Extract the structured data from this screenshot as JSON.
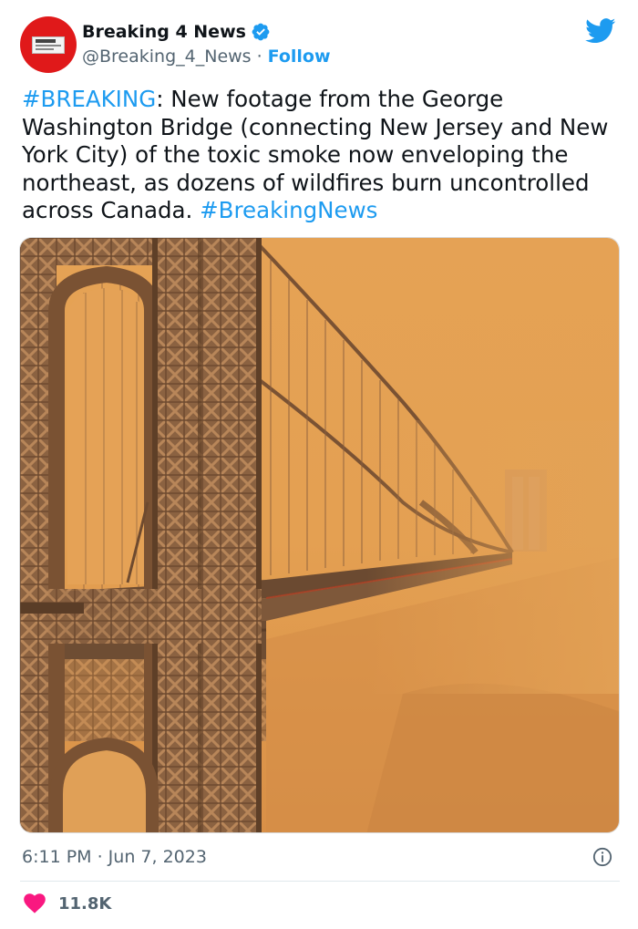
{
  "author": {
    "display_name": "Breaking 4 News",
    "handle": "@Breaking_4_News",
    "separator": "·",
    "follow_label": "Follow",
    "verified": true,
    "avatar_icon": "newspaper-icon",
    "avatar_color": "#e0191a"
  },
  "tweet": {
    "segments": [
      {
        "text": "#BREAKING",
        "type": "hashtag"
      },
      {
        "text": ": New footage from the George Washington Bridge (connecting New Jersey and New York City) of the toxic smoke now enveloping the northeast, as dozens of wildfires burn uncontrolled across Canada. ",
        "type": "text"
      },
      {
        "text": "#BreakingNews",
        "type": "hashtag"
      }
    ],
    "link_color": "#1d9bf0"
  },
  "media": {
    "type": "photo",
    "icon": "bridge-photo"
  },
  "meta": {
    "timestamp": "6:11 PM · Jun 7, 2023"
  },
  "engagement": {
    "likes": "11.8K",
    "like_color": "#f91880"
  },
  "brand": {
    "logo": "twitter-bird-icon",
    "color": "#1d9bf0"
  }
}
